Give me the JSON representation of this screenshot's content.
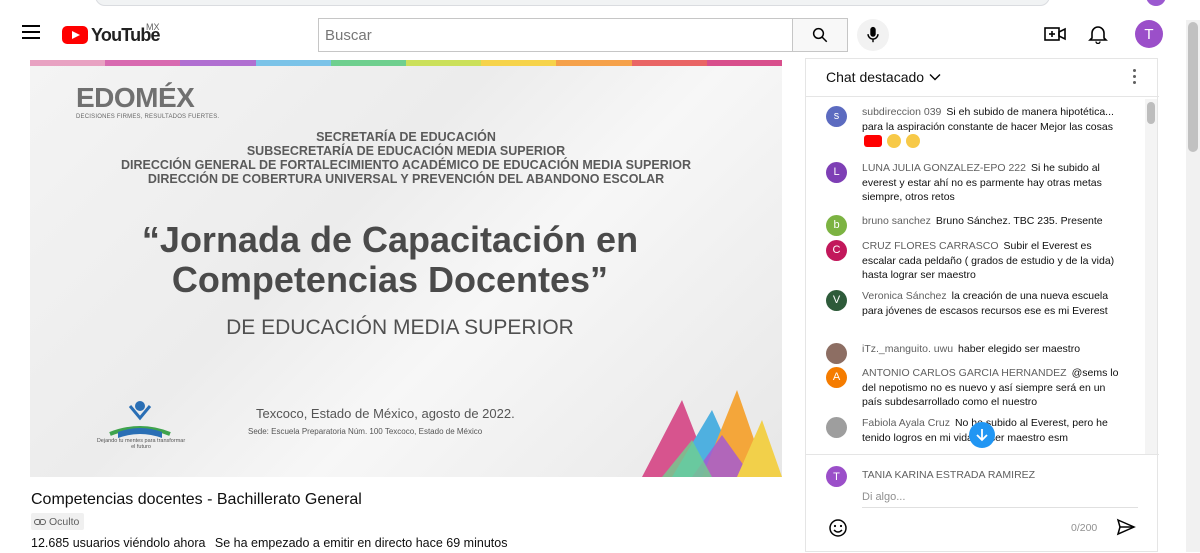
{
  "header": {
    "logo_text": "YouTube",
    "region": "MX",
    "search_placeholder": "Buscar",
    "avatar_letter": "T"
  },
  "video": {
    "brand": "EDOMÉX",
    "brand_tagline": "DECISIONES FIRMES, RESULTADOS FUERTES.",
    "lines": [
      "SECRETARÍA DE EDUCACIÓN",
      "SUBSECRETARÍA DE EDUCACIÓN MEDIA SUPERIOR",
      "DIRECCIÓN GENERAL DE FORTALECIMIENTO ACADÉMICO DE EDUCACIÓN MEDIA SUPERIOR",
      "DIRECCIÓN DE COBERTURA UNIVERSAL Y PREVENCIÓN DEL ABANDONO ESCOLAR"
    ],
    "main_title_1": "“Jornada de Capacitación en",
    "main_title_2": "Competencias Docentes”",
    "sub_title": "DE EDUCACIÓN MEDIA SUPERIOR",
    "place": "Texcoco, Estado de México, agosto de 2022.",
    "sede": "Sede: Escuela Preparatoria Núm. 100 Texcoco, Estado de México",
    "mini_logo_text": "Dejando tu mentes para transformar el futuro"
  },
  "info": {
    "title": "Competencias docentes - Bachillerato General",
    "badge": "Oculto",
    "viewers": "12.685 usuarios viéndolo ahora",
    "started": "Se ha empezado a emitir en directo hace 69 minutos"
  },
  "chat": {
    "title": "Chat destacado",
    "messages": [
      {
        "author": "subdireccion 039",
        "text": "Si eh subido de manera hipotética... para la aspiración constante de hacer Mejor las cosas",
        "initial": "s",
        "color": "#5c6bc0"
      },
      {
        "author": "LUNA JULIA GONZALEZ-EPO 222",
        "text": "Si he subido al everest y estar ahí no es parmente hay otras metas siempre, otros retos",
        "initial": "L",
        "color": "#7e3fb5"
      },
      {
        "author": "bruno sanchez",
        "text": "Bruno Sánchez. TBC 235. Presente",
        "initial": "b",
        "color": "#7cb342"
      },
      {
        "author": "CRUZ FLORES CARRASCO",
        "text": "Subir el Everest es escalar cada peldaño ( grados de estudio y de la vida) hasta lograr ser maestro",
        "initial": "C",
        "color": "#c2185b"
      },
      {
        "author": "Veronica Sánchez",
        "text": "la creación de una nueva escuela para jóvenes de escasos recursos ese es mi Everest",
        "initial": "V",
        "color": "#2e5b3a"
      },
      {
        "author": "iTz._manguito. uwu",
        "text": "haber elegido ser maestro",
        "initial": "",
        "color": "#8d6e63"
      },
      {
        "author": "ANTONIO CARLOS GARCIA HERNANDEZ",
        "text": "@sems lo del nepotismo no es nuevo y así siempre será en un país subdesarrollado como el nuestro",
        "initial": "A",
        "color": "#f57c00"
      },
      {
        "author": "Fabiola Ayala Cruz",
        "text": "No he subido al Everest, pero he tenido logros en mi vida, el ser maestro esm",
        "initial": "",
        "color": "#9e9e9e"
      }
    ],
    "composer_name": "TANIA KARINA ESTRADA RAMIREZ",
    "composer_initial": "T",
    "composer_placeholder": "Di algo...",
    "counter": "0/200"
  }
}
